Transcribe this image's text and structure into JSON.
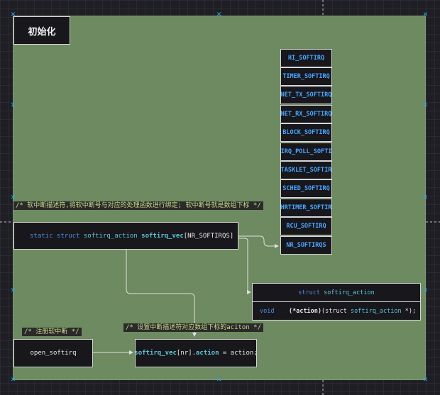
{
  "diagram": {
    "title": "初始化",
    "softirq_types": [
      "HI_SOFTIRQ",
      "TIMER_SOFTIRQ",
      "NET_TX_SOFTIRQ",
      "NET_RX_SOFTIRQ",
      "BLOCK_SOFTIRQ",
      "IRQ_POLL_SOFTI",
      "TASKLET_SOFTIR",
      "SCHED_SOFTIRQ",
      "HRTIMER_SOFTIR",
      "RCU_SOFTIRQ",
      "NR_SOFTIRQS"
    ],
    "comment_vec": "/* 软中断描述符,将软中断号与对应的处理函数进行绑定; 软中断号就是数组下标 */",
    "vec_decl": {
      "kw": "static struct",
      "type": "softirq_action",
      "name": "softirq_vec",
      "size": "[NR_SOFTIRQS]"
    },
    "struct_box": {
      "header_kw": "struct",
      "header_name": "softirq_action",
      "member_void": "void",
      "member_fn": "(*action)",
      "member_params_open": "(struct",
      "member_params_type": "softirq_action",
      "member_params_close": "*);"
    },
    "comment_register": "/* 注册软中断 */",
    "comment_assign": "/* 设置中断描述符对应数组下标的aciton */",
    "open_label": "open_softirq",
    "assign": {
      "vec": "softirq_vec",
      "index": "[nr].",
      "field": "action",
      "rest": " = action;"
    }
  }
}
